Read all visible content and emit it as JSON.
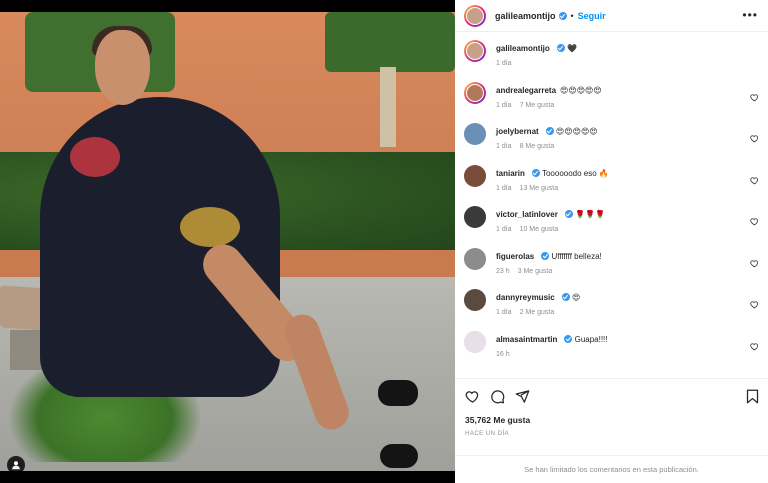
{
  "header": {
    "username": "galileamontijo",
    "separator": "•",
    "follow_label": "Seguir",
    "more_label": "•••"
  },
  "caption": {
    "username": "galileamontijo",
    "text": "🖤",
    "time": "1 día"
  },
  "comments": [
    {
      "username": "andrealegarreta",
      "text": "😍😍😍😍😍",
      "time": "1 día",
      "likes": "7 Me gusta"
    },
    {
      "username": "joelybernat",
      "text": "😍😍😍😍😍",
      "time": "1 día",
      "likes": "8 Me gusta"
    },
    {
      "username": "taniarin",
      "text": "Toooooodo eso 🔥",
      "time": "1 día",
      "likes": "13 Me gusta"
    },
    {
      "username": "victor_latinlover",
      "text": "🌹🌹🌹",
      "time": "1 día",
      "likes": "10 Me gusta"
    },
    {
      "username": "figuerolas",
      "text": "Ufffffff belleza!",
      "time": "23 h",
      "likes": "3 Me gusta"
    },
    {
      "username": "dannyreymusic",
      "text": "😍",
      "time": "1 día",
      "likes": "2 Me gusta"
    },
    {
      "username": "almasaintmartin",
      "text": "Guapa!!!!",
      "time": "16 h",
      "likes": ""
    }
  ],
  "post": {
    "likes_count": "35,762 Me gusta",
    "time_ago": "HACE UN DÍA",
    "comments_limited": "Se han limitado los comentarios en esta publicación."
  },
  "icons": {
    "heart": "heart-icon",
    "comment": "comment-icon",
    "share": "share-icon",
    "bookmark": "bookmark-icon",
    "user": "user-icon"
  },
  "colors": {
    "accent": "#0095f6",
    "verified": "#3897f0",
    "text": "#262626",
    "muted": "#8e8e8e"
  }
}
